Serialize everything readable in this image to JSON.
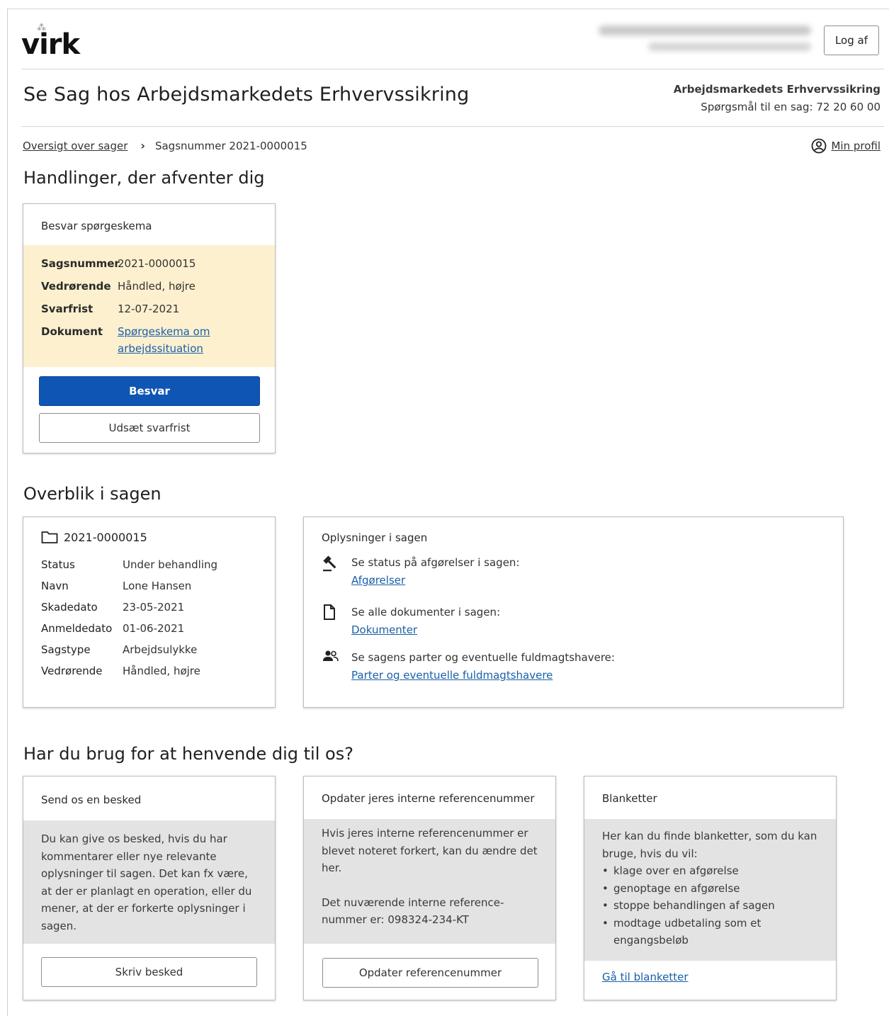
{
  "header": {
    "logo": "virk",
    "logout_label": "Log af"
  },
  "page": {
    "title": "Se Sag hos Arbejdsmarkedets Erhvervssikring",
    "org_name": "Arbejdsmarkedets Erhvervssikring",
    "org_phone": "Spørgsmål til en sag: 72 20 60 00"
  },
  "breadcrumb": {
    "overview_link": "Oversigt over sager",
    "current": "Sagsnummer 2021-0000015",
    "profile_link": "Min profil"
  },
  "pending": {
    "heading": "Handlinger, der afventer dig",
    "card_title": "Besvar spørgeskema",
    "rows": [
      {
        "label": "Sagsnummer",
        "value": "2021-0000015"
      },
      {
        "label": "Vedrørende",
        "value": "Håndled, højre"
      },
      {
        "label": "Svarfrist",
        "value": "12-07-2021"
      }
    ],
    "document_label": "Dokument",
    "document_link_1": "Spørgeskema om",
    "document_link_2": "arbejdssituation",
    "answer_button": "Besvar",
    "postpone_button": "Udsæt svarfrist"
  },
  "overview": {
    "heading": "Overblik i sagen",
    "case_number": "2021-0000015",
    "rows": [
      {
        "label": "Status",
        "value": "Under behandling"
      },
      {
        "label": "Navn",
        "value": "Lone Hansen"
      },
      {
        "label": "Skadedato",
        "value": "23-05-2021"
      },
      {
        "label": "Anmeldedato",
        "value": "01-06-2021"
      },
      {
        "label": "Sagstype",
        "value": "Arbejdsulykke"
      },
      {
        "label": "Vedrørende",
        "value": "Håndled, højre"
      }
    ],
    "info_title": "Oplysninger i sagen",
    "info_items": [
      {
        "text": "Se status på afgørelser i sagen:",
        "link": "Afgørelser",
        "icon": "gavel-icon"
      },
      {
        "text": "Se alle dokumenter i sagen:",
        "link": "Dokumenter",
        "icon": "document-icon"
      },
      {
        "text": "Se sagens parter og eventuelle fuldmagtshavere:",
        "link": "Parter og eventuelle fuldmagtshavere",
        "icon": "people-icon"
      }
    ]
  },
  "contact": {
    "heading": "Har du brug for at henvende dig til os?",
    "message": {
      "title": "Send os en besked",
      "body": "Du kan give os besked, hvis du har kommentarer eller nye relevante oplysninger til sagen. Det kan fx være, at der er planlagt en operation, eller du mener, at der er forkerte oplysninger i sagen.",
      "button": "Skriv besked"
    },
    "reference": {
      "title": "Opdater jeres interne referencenummer",
      "body1": "Hvis jeres interne referencenummer er blevet noteret forkert, kan du ændre det her.",
      "body2": "Det nuværende interne reference-nummer er: 098324-234-KT",
      "button": "Opdater referencenummer"
    },
    "forms": {
      "title": "Blanketter",
      "intro": "Her kan du finde blanketter, som du kan bruge, hvis du vil:",
      "items": [
        "klage over en afgørelse",
        "genoptage en afgørelse",
        "stoppe behandlingen af sagen",
        "modtage udbetaling som et engangsbeløb"
      ],
      "link": "Gå til blanketter"
    }
  }
}
